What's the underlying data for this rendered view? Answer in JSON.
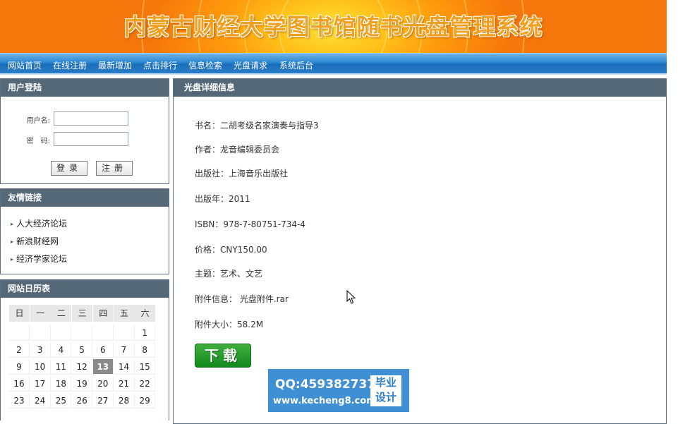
{
  "banner": {
    "title": "内蒙古财经大学图书馆随书光盘管理系统"
  },
  "nav": {
    "items": [
      "网站首页",
      "在线注册",
      "最新增加",
      "点击排行",
      "信息检索",
      "光盘请求",
      "系统后台"
    ]
  },
  "login": {
    "title": "用户登陆",
    "username_label": "用户名:",
    "password_label": "密　码:",
    "username_value": "",
    "password_value": "",
    "login_button": "登录",
    "register_button": "注册"
  },
  "links": {
    "title": "友情链接",
    "items": [
      "人大经济论坛",
      "新浪财经网",
      "经济学家论坛"
    ]
  },
  "calendar": {
    "title": "网站日历表",
    "weekdays": [
      "日",
      "一",
      "二",
      "三",
      "四",
      "五",
      "六"
    ],
    "weeks": [
      [
        "",
        "",
        "",
        "",
        "",
        "",
        "1"
      ],
      [
        "2",
        "3",
        "4",
        "5",
        "6",
        "7",
        "8"
      ],
      [
        "9",
        "10",
        "11",
        "12",
        "13",
        "14",
        "15"
      ],
      [
        "16",
        "17",
        "18",
        "19",
        "20",
        "21",
        "22"
      ],
      [
        "23",
        "24",
        "25",
        "26",
        "27",
        "28",
        "29"
      ]
    ],
    "today": "13"
  },
  "detail": {
    "title": "光盘详细信息",
    "book_name": "书名：二胡考级名家演奏与指导3",
    "author": "作者：龙音编辑委员会",
    "publisher": "出版社：上海音乐出版社",
    "year": "出版年：2011",
    "isbn": "ISBN：978-7-80751-734-4",
    "price": "价格：CNY150.00",
    "subject": "主题：艺术、文艺",
    "attachment": "附件信息：  光盘附件.rar",
    "size": "附件大小：58.2M",
    "download_button": "下载"
  },
  "watermark": {
    "qq": "QQ:459382737",
    "site": "www.kecheng8.com",
    "badge_line1": "毕业",
    "badge_line2": "设计"
  }
}
